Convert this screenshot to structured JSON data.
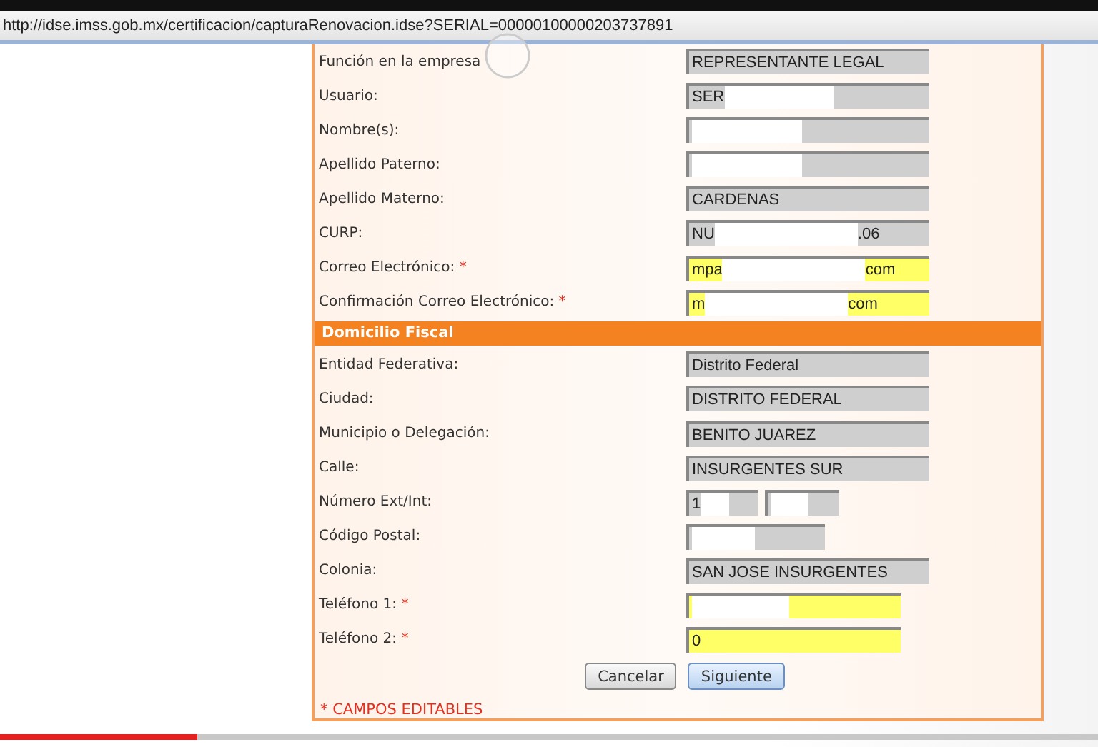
{
  "address_bar": {
    "url": "http://idse.imss.gob.mx/certificacion/capturaRenovacion.idse?SERIAL=00000100000203737891"
  },
  "personal_fields": [
    {
      "label": "Función en la empresa",
      "kind": "full",
      "editable": false,
      "value": "REPRESENTANTE LEGAL"
    },
    {
      "label": "Usuario:",
      "kind": "full",
      "editable": false,
      "value": "SER",
      "redacted": true
    },
    {
      "label": "Nombre(s):",
      "kind": "full",
      "editable": false,
      "redacted": true
    },
    {
      "label": "Apellido Paterno:",
      "kind": "full",
      "editable": false,
      "redacted": true
    },
    {
      "label": "Apellido Materno:",
      "kind": "full",
      "editable": false,
      "value": "CARDENAS"
    },
    {
      "label": "CURP:",
      "kind": "full",
      "editable": false,
      "value": "NU",
      "redacted": true,
      "value_end": ".06"
    },
    {
      "label": "Correo Electrónico:",
      "marker": "*",
      "kind": "full",
      "editable": true,
      "value": "mpa",
      "redacted": true,
      "value_end": "com"
    },
    {
      "label": "Confirmación Correo Electrónico:",
      "marker": "*",
      "kind": "full",
      "editable": true,
      "value": "m",
      "redacted": true,
      "value_end": "com"
    }
  ],
  "fiscal_section": {
    "title": "Domicilio Fiscal",
    "fields": [
      {
        "label": "Entidad Federativa:",
        "kind": "full",
        "editable": false,
        "value": "Distrito Federal"
      },
      {
        "label": "Ciudad:",
        "kind": "full",
        "editable": false,
        "value": "DISTRITO FEDERAL"
      },
      {
        "label": "Municipio o Delegación:",
        "kind": "full",
        "editable": false,
        "value": "BENITO JUAREZ"
      },
      {
        "label": "Calle:",
        "kind": "full",
        "editable": false,
        "value": "INSURGENTES SUR"
      },
      {
        "label": "Número Ext/Int:",
        "kind": "pair",
        "editable": false,
        "value": "1",
        "redacted": true
      },
      {
        "label": "Código Postal:",
        "kind": "medium",
        "editable": false,
        "redacted": true
      },
      {
        "label": "Colonia:",
        "kind": "full",
        "editable": false,
        "value": "SAN JOSE INSURGENTES"
      },
      {
        "label": "Teléfono 1:",
        "marker": "*",
        "kind": "short",
        "editable": true,
        "redacted": true
      },
      {
        "label": "Teléfono 2:",
        "marker": "*",
        "kind": "short",
        "editable": true,
        "value": "0"
      }
    ]
  },
  "buttons": [
    {
      "label": "Cancelar",
      "kind": "default"
    },
    {
      "label": "Siguiente",
      "kind": "primary"
    }
  ],
  "footnote": "* CAMPOS EDITABLES",
  "video_progress": {
    "level": 0.18
  }
}
